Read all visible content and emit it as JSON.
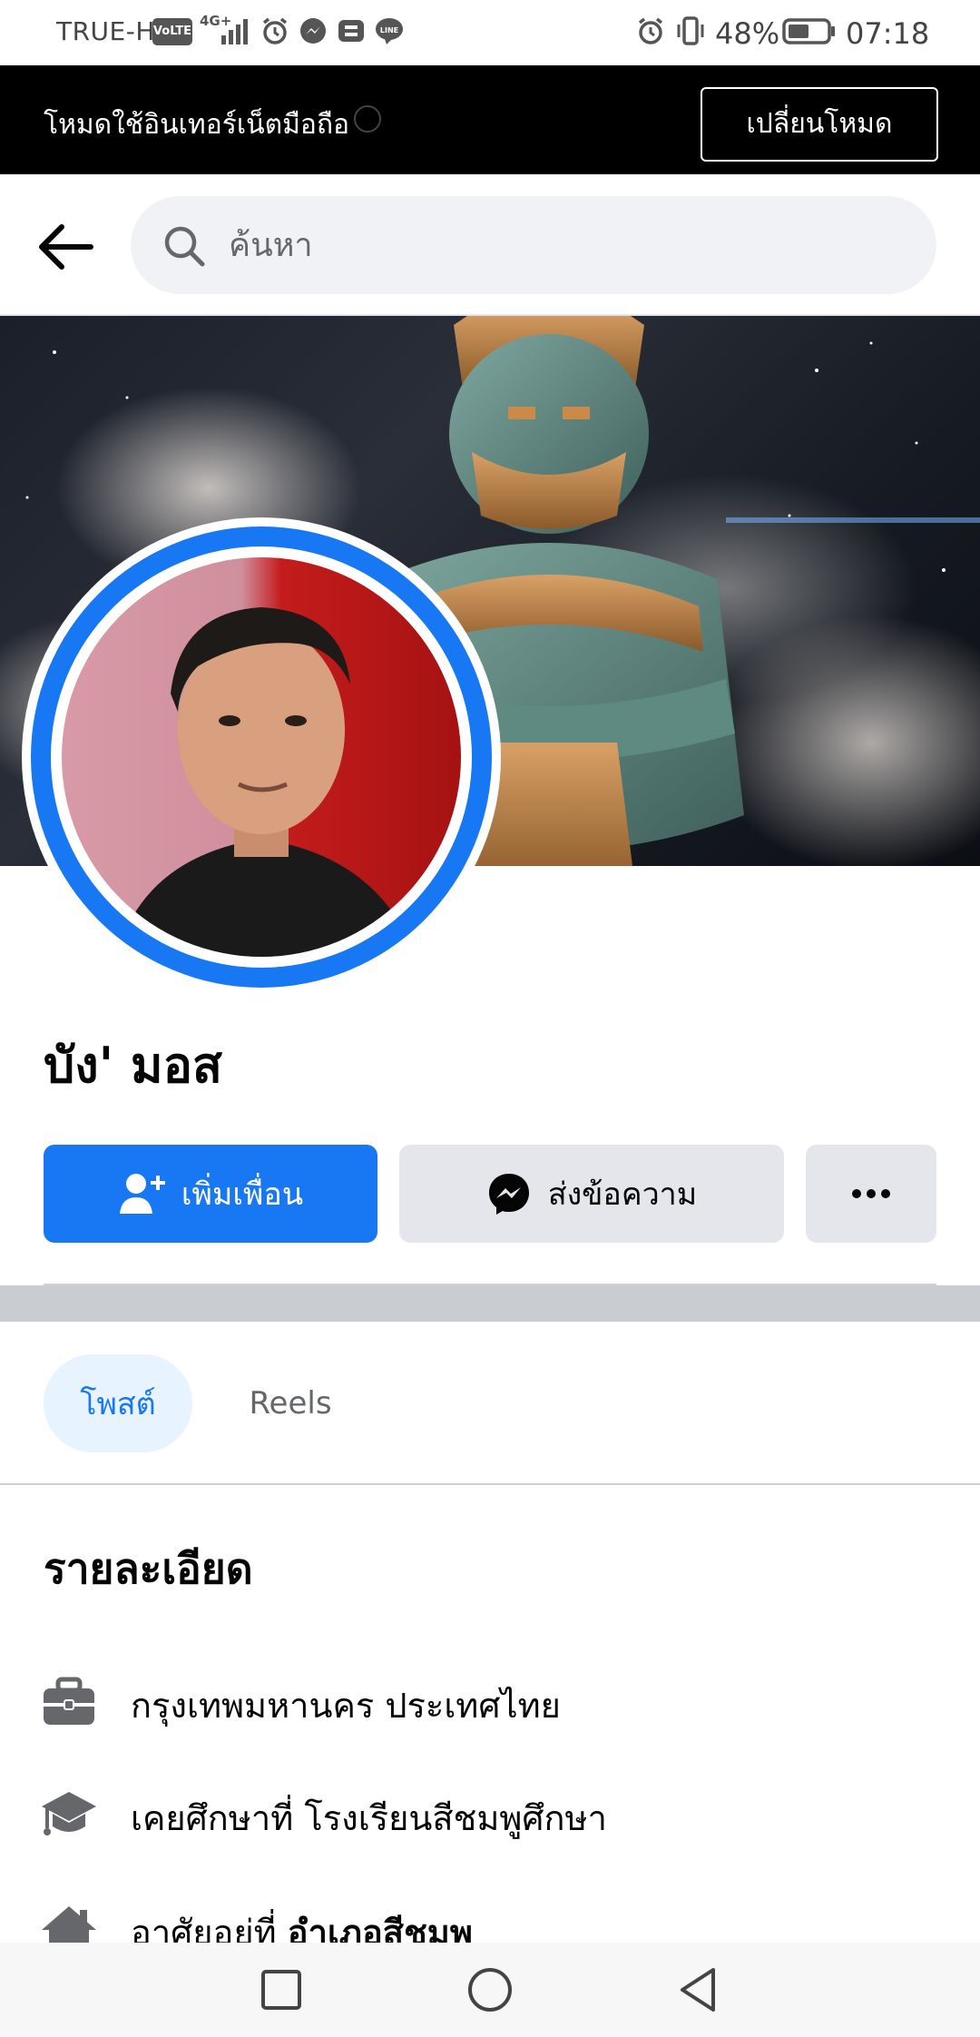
{
  "status_bar": {
    "carrier": "TRUE-H",
    "volte": "VoLTE",
    "network": "4G+",
    "battery": "48%",
    "time": "07:18"
  },
  "data_mode": {
    "text": "โหมดใช้อินเทอร์เน็ตมือถือ",
    "button": "เปลี่ยนโหมด"
  },
  "search": {
    "placeholder": "ค้นหา"
  },
  "profile": {
    "name": "บัง' มอส"
  },
  "actions": {
    "add_friend": "เพิ่มเพื่อน",
    "message": "ส่งข้อความ",
    "more": "..."
  },
  "tabs": [
    {
      "label": "โพสต์",
      "active": true
    },
    {
      "label": "Reels",
      "active": false
    }
  ],
  "details": {
    "heading": "รายละเอียด",
    "items": [
      {
        "icon": "briefcase-icon",
        "text": "กรุงเทพมหานคร ประเทศไทย"
      },
      {
        "icon": "graduation-cap-icon",
        "text": "เคยศึกษาที่ โรงเรียนสีชมพูศึกษา"
      },
      {
        "icon": "home-icon",
        "prefix": "อาศัยอยู่ที่ ",
        "bold": "อำเภอสีชมพ"
      }
    ]
  },
  "colors": {
    "accent": "#1877f2",
    "tab_active_bg": "#e7f3ff",
    "button_secondary": "#e4e6eb"
  }
}
